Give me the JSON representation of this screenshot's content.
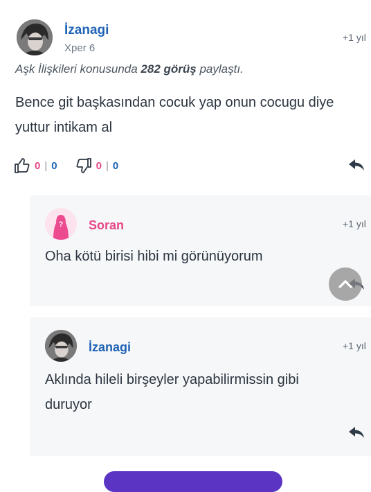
{
  "post": {
    "username": "İzanagi",
    "level": "Xper 6",
    "time": "+1 yıl",
    "shared_prefix": "Aşk İlişkileri konusunda ",
    "shared_count": "282 görüş",
    "shared_suffix": " paylaştı.",
    "body": "Bence git başkasından cocuk yap onun cocugu diye yuttur intikam al",
    "likes": {
      "pink": "0",
      "sep": "|",
      "blue": "0"
    },
    "dislikes": {
      "pink": "0",
      "sep": "|",
      "blue": "0"
    }
  },
  "replies": [
    {
      "author": "Soran",
      "time": "+1 yıl",
      "text": "Oha kötü birisi hibi mi görünüyorum"
    },
    {
      "author": "İzanagi",
      "time": "+1 yıl",
      "text": "Aklında hileli birşeyler yapabilirmissin gibi duruyor"
    }
  ],
  "icons": {
    "like": "thumbs-up-icon",
    "dislike": "thumbs-down-icon",
    "reply": "reply-arrow-icon",
    "scroll_top": "chevron-up-icon"
  },
  "colors": {
    "username": "#1f63b5",
    "soran": "#e64787",
    "vote_pink": "#e64787",
    "vote_blue": "#1f63b5",
    "card_bg": "#f6f7f8",
    "button": "#5b34c4"
  }
}
